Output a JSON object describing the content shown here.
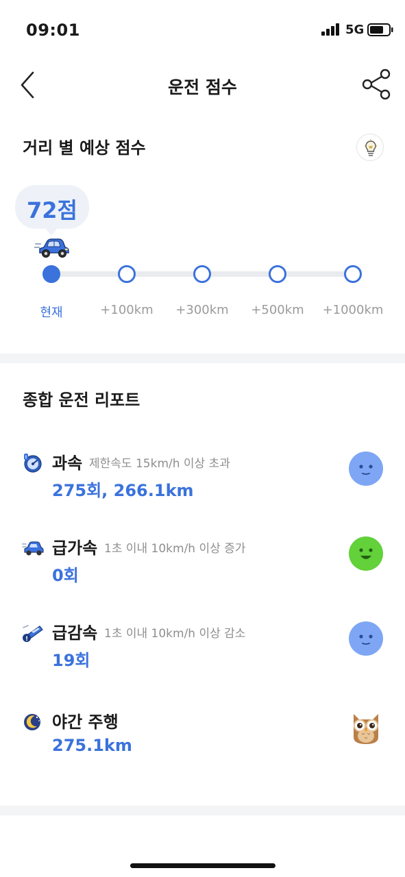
{
  "status_bar": {
    "time": "09:01",
    "network": "5G"
  },
  "header": {
    "title": "운전 점수",
    "back_icon": "chevron-left-icon",
    "share_icon": "share-icon"
  },
  "forecast": {
    "title": "거리 별 예상 점수",
    "tip_icon": "lightbulb-icon",
    "score_label": "72점",
    "steps": [
      "현재",
      "+100km",
      "+300km",
      "+500km",
      "+1000km"
    ],
    "active_step": 0
  },
  "report": {
    "title": "종합 운전 리포트",
    "items": [
      {
        "name": "과속",
        "description": "제한속도 15km/h 이상 초과",
        "value": "275회, 266.1km",
        "icon": "speedometer-icon",
        "status_icon": "neutral-face-icon",
        "status_color": "#7ea6f4"
      },
      {
        "name": "급가속",
        "description": "1초 이내 10km/h 이상 증가",
        "value": "0회",
        "icon": "car-accelerate-icon",
        "status_icon": "smile-face-icon",
        "status_color": "#62d13a"
      },
      {
        "name": "급감속",
        "description": "1초 이내 10km/h 이상 감소",
        "value": "19회",
        "icon": "brake-warning-icon",
        "status_icon": "neutral-face-icon",
        "status_color": "#7ea6f4"
      },
      {
        "name": "야간 주행",
        "description": "",
        "value": "275.1km",
        "icon": "moon-icon",
        "status_icon": "owl-icon",
        "status_color": "#c9935a"
      }
    ]
  },
  "colors": {
    "accent": "#3b72dc",
    "divider": "#f3f4f6"
  }
}
